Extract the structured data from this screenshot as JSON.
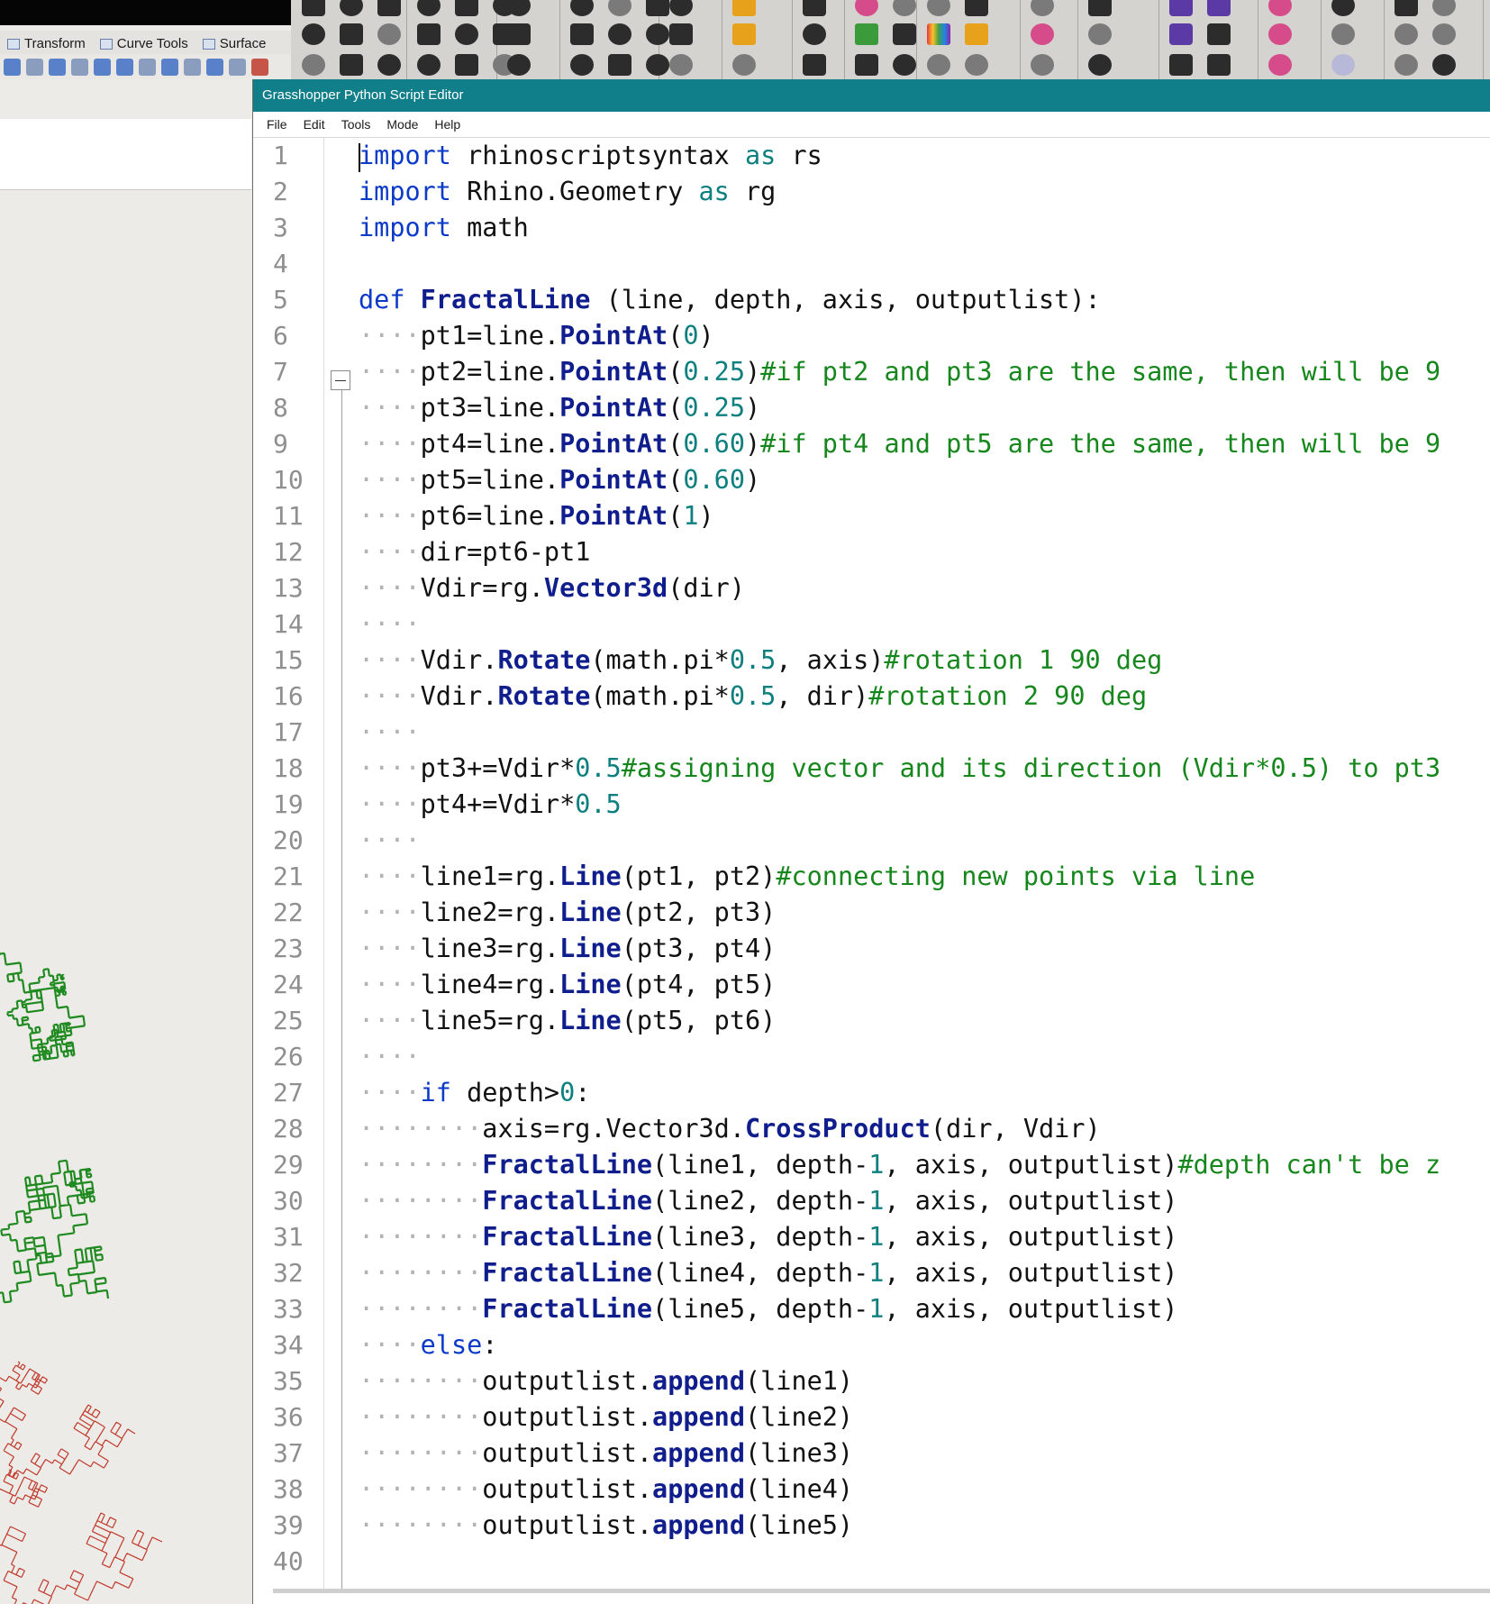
{
  "rhino": {
    "tabs": [
      "Transform",
      "Curve Tools",
      "Surface"
    ]
  },
  "editor": {
    "title": "Grasshopper Python Script Editor",
    "menu": [
      "File",
      "Edit",
      "Tools",
      "Mode",
      "Help"
    ],
    "lines": [
      {
        "n": "1",
        "indent": 0,
        "tokens": [
          [
            "kw",
            "import"
          ],
          [
            "t",
            " rhinoscriptsyntax "
          ],
          [
            "opk",
            "as"
          ],
          [
            "t",
            " rs"
          ]
        ]
      },
      {
        "n": "2",
        "indent": 0,
        "tokens": [
          [
            "kw",
            "import"
          ],
          [
            "t",
            " Rhino.Geometry "
          ],
          [
            "opk",
            "as"
          ],
          [
            "t",
            " rg"
          ]
        ]
      },
      {
        "n": "3",
        "indent": 0,
        "tokens": [
          [
            "kw",
            "import"
          ],
          [
            "t",
            " math"
          ]
        ]
      },
      {
        "n": "4",
        "indent": 0,
        "tokens": []
      },
      {
        "n": "5",
        "indent": 0,
        "tokens": [
          [
            "kw",
            "def"
          ],
          [
            "t",
            " "
          ],
          [
            "fn",
            "FractalLine"
          ],
          [
            "t",
            " (line, depth, axis, outputlist):"
          ]
        ]
      },
      {
        "n": "6",
        "indent": 1,
        "tokens": [
          [
            "t",
            "pt1=line."
          ],
          [
            "fn",
            "PointAt"
          ],
          [
            "t",
            "("
          ],
          [
            "num",
            "0"
          ],
          [
            "t",
            ")"
          ]
        ]
      },
      {
        "n": "7",
        "indent": 1,
        "tokens": [
          [
            "t",
            "pt2=line."
          ],
          [
            "fn",
            "PointAt"
          ],
          [
            "t",
            "("
          ],
          [
            "num",
            "0.25"
          ],
          [
            "t",
            ")"
          ],
          [
            "cm",
            "#if pt2 and pt3 are the same, then will be 9"
          ]
        ]
      },
      {
        "n": "8",
        "indent": 1,
        "tokens": [
          [
            "t",
            "pt3=line."
          ],
          [
            "fn",
            "PointAt"
          ],
          [
            "t",
            "("
          ],
          [
            "num",
            "0.25"
          ],
          [
            "t",
            ")"
          ]
        ]
      },
      {
        "n": "9",
        "indent": 1,
        "tokens": [
          [
            "t",
            "pt4=line."
          ],
          [
            "fn",
            "PointAt"
          ],
          [
            "t",
            "("
          ],
          [
            "num",
            "0.60"
          ],
          [
            "t",
            ")"
          ],
          [
            "cm",
            "#if pt4 and pt5 are the same, then will be 9"
          ]
        ]
      },
      {
        "n": "10",
        "indent": 1,
        "tokens": [
          [
            "t",
            "pt5=line."
          ],
          [
            "fn",
            "PointAt"
          ],
          [
            "t",
            "("
          ],
          [
            "num",
            "0.60"
          ],
          [
            "t",
            ")"
          ]
        ]
      },
      {
        "n": "11",
        "indent": 1,
        "tokens": [
          [
            "t",
            "pt6=line."
          ],
          [
            "fn",
            "PointAt"
          ],
          [
            "t",
            "("
          ],
          [
            "num",
            "1"
          ],
          [
            "t",
            ")"
          ]
        ]
      },
      {
        "n": "12",
        "indent": 1,
        "tokens": [
          [
            "t",
            "dir=pt6-pt1"
          ]
        ]
      },
      {
        "n": "13",
        "indent": 1,
        "tokens": [
          [
            "t",
            "Vdir=rg."
          ],
          [
            "fn",
            "Vector3d"
          ],
          [
            "t",
            "(dir)"
          ]
        ]
      },
      {
        "n": "14",
        "indent": 1,
        "tokens": []
      },
      {
        "n": "15",
        "indent": 1,
        "tokens": [
          [
            "t",
            "Vdir."
          ],
          [
            "fn",
            "Rotate"
          ],
          [
            "t",
            "(math.pi*"
          ],
          [
            "num",
            "0.5"
          ],
          [
            "t",
            ", axis)"
          ],
          [
            "cm",
            "#rotation 1 90 deg"
          ]
        ]
      },
      {
        "n": "16",
        "indent": 1,
        "tokens": [
          [
            "t",
            "Vdir."
          ],
          [
            "fn",
            "Rotate"
          ],
          [
            "t",
            "(math.pi*"
          ],
          [
            "num",
            "0.5"
          ],
          [
            "t",
            ", dir)"
          ],
          [
            "cm",
            "#rotation 2 90 deg"
          ]
        ]
      },
      {
        "n": "17",
        "indent": 1,
        "tokens": []
      },
      {
        "n": "18",
        "indent": 1,
        "tokens": [
          [
            "t",
            "pt3+=Vdir*"
          ],
          [
            "num",
            "0.5"
          ],
          [
            "cm",
            "#assigning vector and its direction (Vdir*0.5) to pt3"
          ]
        ]
      },
      {
        "n": "19",
        "indent": 1,
        "tokens": [
          [
            "t",
            "pt4+=Vdir*"
          ],
          [
            "num",
            "0.5"
          ]
        ]
      },
      {
        "n": "20",
        "indent": 1,
        "tokens": []
      },
      {
        "n": "21",
        "indent": 1,
        "tokens": [
          [
            "t",
            "line1=rg."
          ],
          [
            "fn",
            "Line"
          ],
          [
            "t",
            "(pt1, pt2)"
          ],
          [
            "cm",
            "#connecting new points via line"
          ]
        ]
      },
      {
        "n": "22",
        "indent": 1,
        "tokens": [
          [
            "t",
            "line2=rg."
          ],
          [
            "fn",
            "Line"
          ],
          [
            "t",
            "(pt2, pt3)"
          ]
        ]
      },
      {
        "n": "23",
        "indent": 1,
        "tokens": [
          [
            "t",
            "line3=rg."
          ],
          [
            "fn",
            "Line"
          ],
          [
            "t",
            "(pt3, pt4)"
          ]
        ]
      },
      {
        "n": "24",
        "indent": 1,
        "tokens": [
          [
            "t",
            "line4=rg."
          ],
          [
            "fn",
            "Line"
          ],
          [
            "t",
            "(pt4, pt5)"
          ]
        ]
      },
      {
        "n": "25",
        "indent": 1,
        "tokens": [
          [
            "t",
            "line5=rg."
          ],
          [
            "fn",
            "Line"
          ],
          [
            "t",
            "(pt5, pt6)"
          ]
        ]
      },
      {
        "n": "26",
        "indent": 1,
        "tokens": []
      },
      {
        "n": "27",
        "indent": 1,
        "tokens": [
          [
            "kw",
            "if"
          ],
          [
            "t",
            " depth>"
          ],
          [
            "num",
            "0"
          ],
          [
            "t",
            ":"
          ]
        ]
      },
      {
        "n": "28",
        "indent": 2,
        "tokens": [
          [
            "t",
            "axis=rg.Vector3d."
          ],
          [
            "fn",
            "CrossProduct"
          ],
          [
            "t",
            "(dir, Vdir)"
          ]
        ]
      },
      {
        "n": "29",
        "indent": 2,
        "tokens": [
          [
            "fn",
            "FractalLine"
          ],
          [
            "t",
            "(line1, depth-"
          ],
          [
            "num",
            "1"
          ],
          [
            "t",
            ", axis, outputlist)"
          ],
          [
            "cm",
            "#depth can't be z"
          ]
        ]
      },
      {
        "n": "30",
        "indent": 2,
        "tokens": [
          [
            "fn",
            "FractalLine"
          ],
          [
            "t",
            "(line2, depth-"
          ],
          [
            "num",
            "1"
          ],
          [
            "t",
            ", axis, outputlist)"
          ]
        ]
      },
      {
        "n": "31",
        "indent": 2,
        "tokens": [
          [
            "fn",
            "FractalLine"
          ],
          [
            "t",
            "(line3, depth-"
          ],
          [
            "num",
            "1"
          ],
          [
            "t",
            ", axis, outputlist)"
          ]
        ]
      },
      {
        "n": "32",
        "indent": 2,
        "tokens": [
          [
            "fn",
            "FractalLine"
          ],
          [
            "t",
            "(line4, depth-"
          ],
          [
            "num",
            "1"
          ],
          [
            "t",
            ", axis, outputlist)"
          ]
        ]
      },
      {
        "n": "33",
        "indent": 2,
        "tokens": [
          [
            "fn",
            "FractalLine"
          ],
          [
            "t",
            "(line5, depth-"
          ],
          [
            "num",
            "1"
          ],
          [
            "t",
            ", axis, outputlist)"
          ]
        ]
      },
      {
        "n": "34",
        "indent": 1,
        "tokens": [
          [
            "kw",
            "else"
          ],
          [
            "t",
            ":"
          ]
        ]
      },
      {
        "n": "35",
        "indent": 2,
        "tokens": [
          [
            "t",
            "outputlist."
          ],
          [
            "fn",
            "append"
          ],
          [
            "t",
            "(line1)"
          ]
        ]
      },
      {
        "n": "36",
        "indent": 2,
        "tokens": [
          [
            "t",
            "outputlist."
          ],
          [
            "fn",
            "append"
          ],
          [
            "t",
            "(line2)"
          ]
        ]
      },
      {
        "n": "37",
        "indent": 2,
        "tokens": [
          [
            "t",
            "outputlist."
          ],
          [
            "fn",
            "append"
          ],
          [
            "t",
            "(line3)"
          ]
        ]
      },
      {
        "n": "38",
        "indent": 2,
        "tokens": [
          [
            "t",
            "outputlist."
          ],
          [
            "fn",
            "append"
          ],
          [
            "t",
            "(line4)"
          ]
        ]
      },
      {
        "n": "39",
        "indent": 2,
        "tokens": [
          [
            "t",
            "outputlist."
          ],
          [
            "fn",
            "append"
          ],
          [
            "t",
            "(line5)"
          ]
        ]
      },
      {
        "n": "40",
        "indent": 0,
        "tokens": []
      }
    ]
  }
}
